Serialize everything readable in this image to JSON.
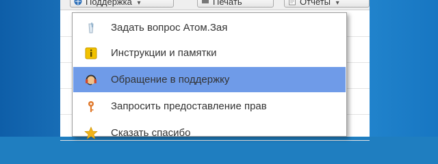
{
  "toolbar": {
    "support_label": "Поддержка",
    "print_label": "Печать",
    "reports_label": "Отчеты"
  },
  "menu": {
    "items": [
      {
        "label": "Задать вопрос Атом.Зая",
        "icon": "glass-icon"
      },
      {
        "label": "Инструкции и памятки",
        "icon": "info-icon"
      },
      {
        "label": "Обращение в поддержку",
        "icon": "headset-icon",
        "selected": true
      },
      {
        "label": "Запросить предоставление прав",
        "icon": "key-icon"
      },
      {
        "label": "Сказать спасибо",
        "icon": "star-icon"
      }
    ]
  },
  "colors": {
    "desktop": "#1f7ec0",
    "selected": "#6f9be8",
    "info_icon": "#f2c200",
    "key_icon": "#e0792c",
    "star_icon": "#f0b31a",
    "headset_icon": "#d04a2b"
  }
}
